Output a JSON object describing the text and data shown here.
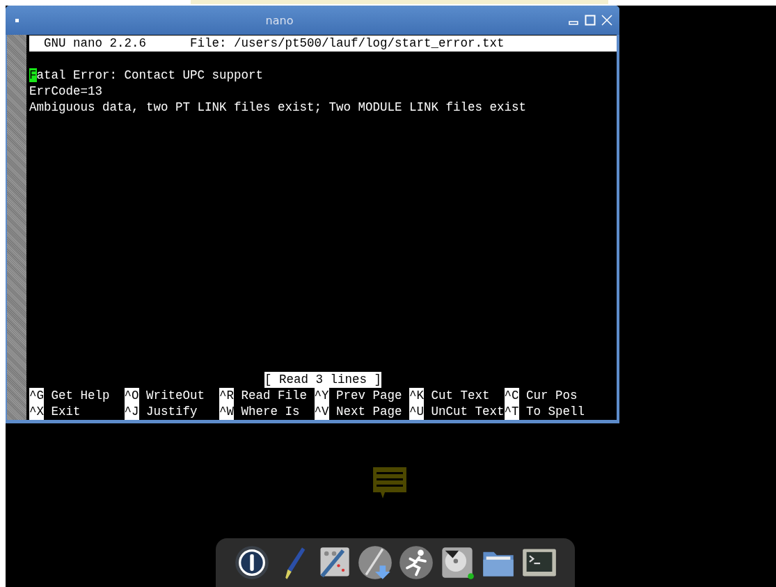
{
  "window": {
    "title": "nano"
  },
  "editor": {
    "header": "  GNU nano 2.2.6      File: /users/pt500/lauf/log/start_error.txt",
    "lines": [
      {
        "text": "Fatal Error: Contact UPC support",
        "cursor": true
      },
      {
        "text": "ErrCode=13",
        "cursor": false
      },
      {
        "text": "Ambiguous data, two PT LINK files exist; Two MODULE LINK files exist",
        "cursor": false
      }
    ],
    "status": "[ Read 3 lines ]",
    "shortcuts": [
      [
        {
          "key": "^G",
          "label": "Get Help"
        },
        {
          "key": "^O",
          "label": "WriteOut"
        },
        {
          "key": "^R",
          "label": "Read File"
        },
        {
          "key": "^Y",
          "label": "Prev Page"
        },
        {
          "key": "^K",
          "label": "Cut Text"
        },
        {
          "key": "^C",
          "label": "Cur Pos"
        }
      ],
      [
        {
          "key": "^X",
          "label": "Exit"
        },
        {
          "key": "^J",
          "label": "Justify"
        },
        {
          "key": "^W",
          "label": "Where Is"
        },
        {
          "key": "^V",
          "label": "Next Page"
        },
        {
          "key": "^U",
          "label": "UnCut Text"
        },
        {
          "key": "^T",
          "label": "To Spell"
        }
      ]
    ]
  },
  "dock": {
    "items": [
      {
        "kind": "power"
      },
      {
        "kind": "brush"
      },
      {
        "kind": "tools"
      },
      {
        "kind": "install"
      },
      {
        "kind": "runner"
      },
      {
        "kind": "disk"
      },
      {
        "kind": "folder"
      },
      {
        "kind": "terminal"
      }
    ]
  }
}
